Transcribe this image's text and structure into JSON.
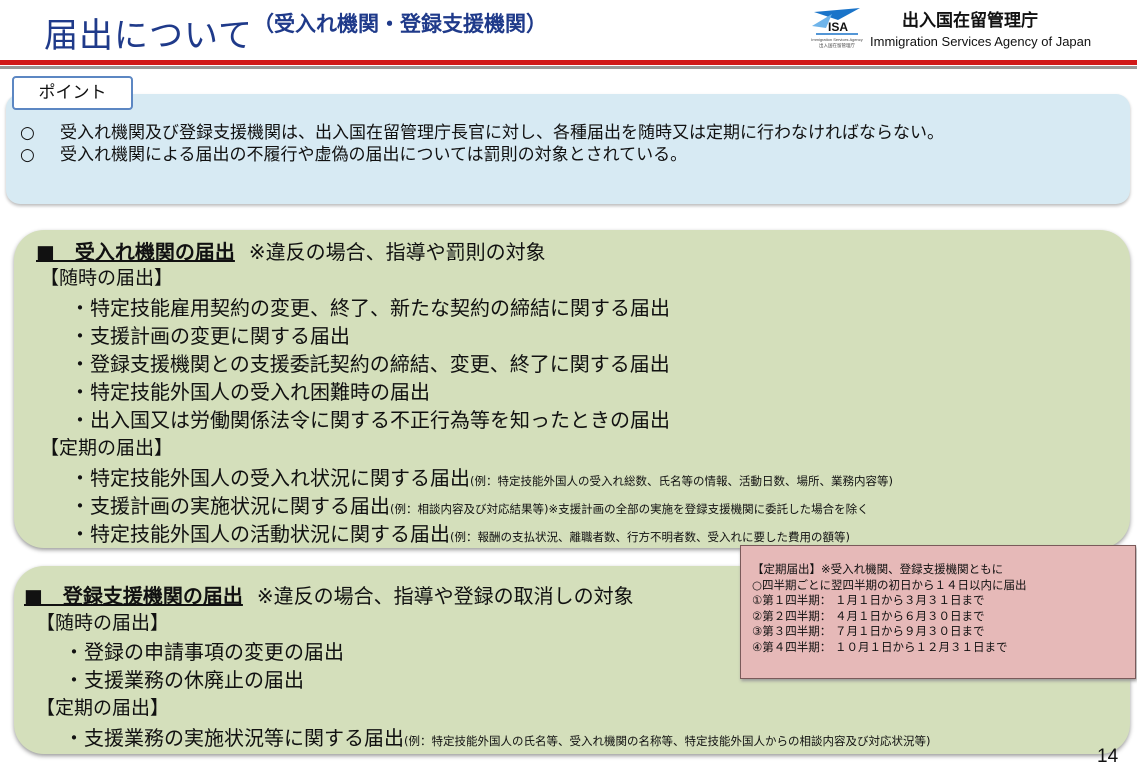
{
  "header": {
    "title_main": "届出について",
    "title_sub": "（受入れ機関・登録支援機関）",
    "logo_text": "ISA",
    "logo_small_1": "Immigration Services Agency",
    "logo_small_2": "出入国在留管理庁",
    "org_ja": "出入国在留管理庁",
    "org_en": "Immigration Services Agency of Japan"
  },
  "point": {
    "label": "ポイント",
    "mark": "○",
    "items": [
      "受入れ機関及び登録支援機関は、出入国在留管理庁長官に対し、各種届出を随時又は定期に行わなければならない。",
      "受入れ機関による届出の不履行や虚偽の届出については罰則の対象とされている。"
    ]
  },
  "section1": {
    "heading": "■　受入れ機関の届出",
    "note": "※違反の場合、指導や罰則の対象",
    "adhoc_label": "【随時の届出】",
    "adhoc_items": [
      "・特定技能雇用契約の変更、終了、新たな契約の締結に関する届出",
      "・支援計画の変更に関する届出",
      "・登録支援機関との支援委託契約の締結、変更、終了に関する届出",
      "・特定技能外国人の受入れ困難時の届出",
      "・出入国又は労働関係法令に関する不正行為等を知ったときの届出"
    ],
    "periodic_label": "【定期の届出】",
    "periodic_items": [
      {
        "text": "・特定技能外国人の受入れ状況に関する届出",
        "note": "(例：特定技能外国人の受入れ総数、氏名等の情報、活動日数、場所、業務内容等)"
      },
      {
        "text": "・支援計画の実施状況に関する届出",
        "note": "(例：相談内容及び対応結果等)※支援計画の全部の実施を登録支援機関に委託した場合を除く"
      },
      {
        "text": "・特定技能外国人の活動状況に関する届出",
        "note": "(例：報酬の支払状況、離職者数、行方不明者数、受入れに要した費用の額等)"
      }
    ]
  },
  "section2": {
    "heading": "■　登録支援機関の届出",
    "note": "※違反の場合、指導や登録の取消しの対象",
    "adhoc_label": "【随時の届出】",
    "adhoc_items": [
      "・登録の申請事項の変更の届出",
      "・支援業務の休廃止の届出"
    ],
    "periodic_label": "【定期の届出】",
    "periodic_items": [
      {
        "text": "・支援業務の実施状況等に関する届出",
        "note": "(例：特定技能外国人の氏名等、受入れ機関の名称等、特定技能外国人からの相談内容及び対応状況等)"
      }
    ]
  },
  "schedule_note": {
    "lines": [
      "【定期届出】※受入れ機関、登録支援機関ともに",
      "○四半期ごとに翌四半期の初日から１４日以内に届出",
      "①第１四半期： １月１日から３月３１日まで",
      "②第２四半期： ４月１日から６月３０日まで",
      "③第３四半期： ７月１日から９月３０日まで",
      "④第４四半期： １０月１日から１２月３１日まで"
    ]
  },
  "page_number": "14",
  "colors": {
    "title": "#1f3a8a",
    "rule_red": "#d11a1a",
    "point_bg": "#d7eaf3",
    "section_bg": "#d4dfbb",
    "note_bg": "#e6b9b8"
  }
}
